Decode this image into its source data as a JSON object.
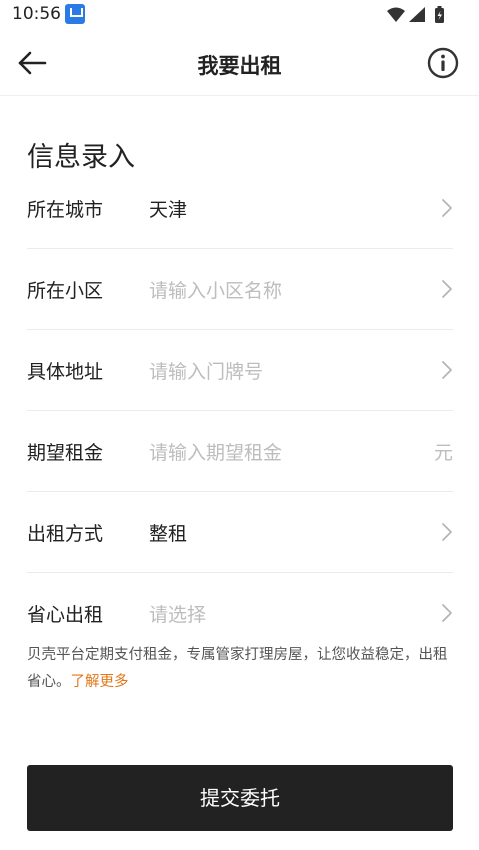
{
  "status_bar": {
    "time": "10:56",
    "app_icon": "app-notification-icon"
  },
  "nav": {
    "title": "我要出租",
    "back_icon": "arrow-left-icon",
    "info_icon": "info-circle-icon"
  },
  "section_title": "信息录入",
  "form": {
    "rows": [
      {
        "label": "所在城市",
        "value": "天津",
        "placeholder": "",
        "trailing": "chevron-right-icon"
      },
      {
        "label": "所在小区",
        "value": "",
        "placeholder": "请输入小区名称",
        "trailing": "chevron-right-icon"
      },
      {
        "label": "具体地址",
        "value": "",
        "placeholder": "请输入门牌号",
        "trailing": "chevron-right-icon"
      },
      {
        "label": "期望租金",
        "value": "",
        "placeholder": "请输入期望租金",
        "unit": "元"
      },
      {
        "label": "出租方式",
        "value": "整租",
        "placeholder": "",
        "trailing": "chevron-right-icon"
      },
      {
        "label": "省心出租",
        "value": "",
        "placeholder": "请选择",
        "trailing": "chevron-right-icon"
      }
    ]
  },
  "hint": {
    "text": "贝壳平台定期支付租金，专属管家打理房屋，让您收益稳定，出租省心。",
    "link": "了解更多"
  },
  "submit_label": "提交委托",
  "colors": {
    "accent_link": "#e0771b",
    "button_bg": "#222222",
    "placeholder": "#bdbdbd"
  }
}
